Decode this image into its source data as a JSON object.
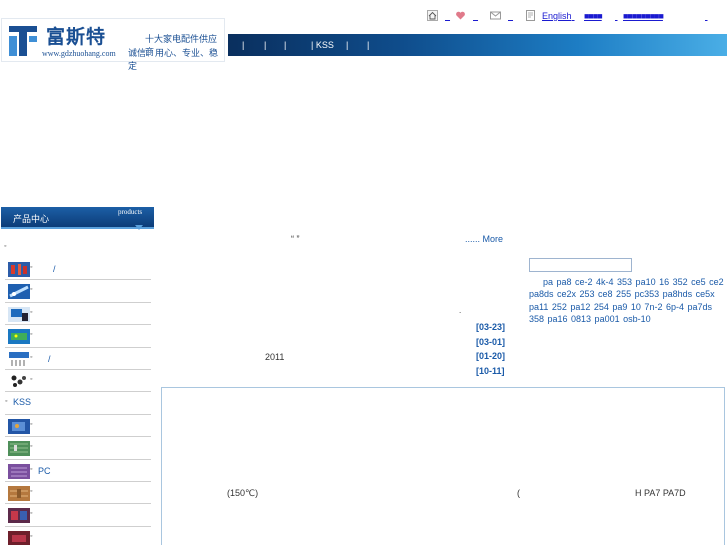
{
  "header": {
    "logo_text": "富斯特",
    "logo_url": "www.gdzhuohang.com",
    "slogan_top": "十大家电配件供应商",
    "slogan_bottom": "诚信、用心、专业、稳定"
  },
  "top_links": {
    "english": "English",
    "link_a": "■■■■",
    "link_b": "■■■■■■■■■"
  },
  "nav": {
    "items": [
      "|",
      "|",
      "|",
      "| KSS",
      "|",
      "|"
    ]
  },
  "sidebar": {
    "title": "产品中心",
    "title_en": "products",
    "items": [
      {
        "label": "/",
        "thumb": "red-connector"
      },
      {
        "label": "",
        "thumb": "blue-cable"
      },
      {
        "label": "",
        "thumb": "blue-module"
      },
      {
        "label": "",
        "thumb": "green-board"
      },
      {
        "label": "/",
        "thumb": "blue-terminals"
      },
      {
        "label": "",
        "thumb": "black-parts"
      },
      {
        "label": "KSS",
        "thumb": ""
      },
      {
        "label": "",
        "thumb": "blue-board"
      },
      {
        "label": "",
        "thumb": "green-pcb"
      },
      {
        "label": "PC",
        "thumb": "purple-pcb"
      },
      {
        "label": "",
        "thumb": "brown-pcb"
      },
      {
        "label": "",
        "thumb": "red-pcb"
      },
      {
        "label": "",
        "thumb": "dark-red-pcb"
      }
    ]
  },
  "main": {
    "quote_marks": "“ ”",
    "more_link": "...... More",
    "dot": ".",
    "year_text": "2011",
    "news_dates": [
      "[03-23]",
      "[03-01]",
      "[01-20]",
      "[10-11]"
    ],
    "search_value": "",
    "keywords": "pa pa8 ce-2 4k-4 353 pa10 16 352 ce5 ce2 pa8ds ce2x 253 ce8 255 pc353 pa8hds ce5x pa11 252 pa12 254 pa9 10 7n-2 6p-4 pa7ds 358 pa16 0813   pa001 osb-10",
    "temp_text": "(150℃)",
    "paren_text": "(",
    "model_text": "H  PA7 PA7D"
  },
  "colors": {
    "brand_blue": "#1a4f93",
    "link_blue": "#1a5aa8",
    "nav_dark": "#0a2f5e",
    "nav_light": "#4aaee6"
  }
}
